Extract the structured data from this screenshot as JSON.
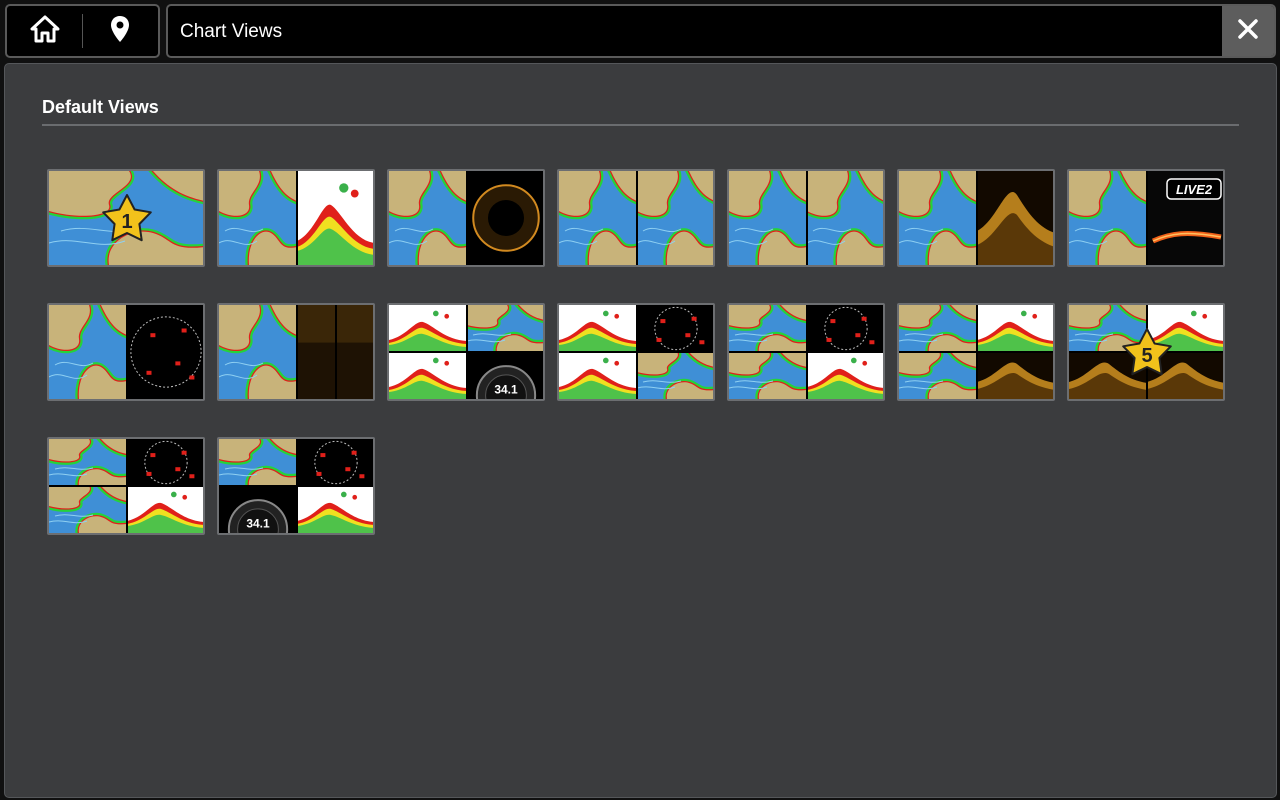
{
  "header": {
    "home_icon": "home-icon",
    "waypoint_icon": "map-pin-icon",
    "title": "Chart Views",
    "close_icon": "close-icon"
  },
  "section": {
    "title": "Default Views"
  },
  "colors": {
    "panel_bg": "#3b3c3e",
    "water": "#3f8fd6",
    "land": "#c8b37a",
    "shallow_green": "#25d33a",
    "contour_red": "#e0201a",
    "star": "#f2c21b",
    "live_text": "LIVE2"
  },
  "views": [
    {
      "id": 1,
      "panes": [
        "chart"
      ],
      "badge": "1"
    },
    {
      "id": 2,
      "panes": [
        "chart",
        "sonar2d"
      ],
      "badge": ""
    },
    {
      "id": 3,
      "panes": [
        "chart",
        "circular"
      ],
      "badge": ""
    },
    {
      "id": 4,
      "panes": [
        "chart",
        "chart"
      ],
      "badge": ""
    },
    {
      "id": 5,
      "panes": [
        "chart",
        "chart"
      ],
      "badge": ""
    },
    {
      "id": 6,
      "panes": [
        "chart",
        "downimage"
      ],
      "badge": ""
    },
    {
      "id": 7,
      "panes": [
        "chart",
        "live"
      ],
      "badge": "",
      "live_label": "LIVE2"
    },
    {
      "id": 8,
      "panes": [
        "chart",
        "radar"
      ],
      "badge": ""
    },
    {
      "id": 9,
      "panes": [
        "chart",
        "sideimage"
      ],
      "badge": ""
    },
    {
      "id": 10,
      "panes": [
        "sonar2d",
        "chart",
        "sonar2d",
        "gauge"
      ],
      "badge": "",
      "gauge_value": "34.1"
    },
    {
      "id": 11,
      "panes": [
        "sonar2d",
        "radar",
        "sonar2d",
        "chart"
      ],
      "badge": ""
    },
    {
      "id": 12,
      "panes": [
        "chart",
        "radar",
        "chart",
        "sonar2d"
      ],
      "badge": ""
    },
    {
      "id": 13,
      "panes": [
        "chart",
        "sonar2d",
        "chart",
        "downimage"
      ],
      "badge": ""
    },
    {
      "id": 14,
      "panes": [
        "chart",
        "sonar2d",
        "downimage",
        "downimage"
      ],
      "badge": "5"
    },
    {
      "id": 15,
      "panes": [
        "chart",
        "radar",
        "chart",
        "sonar2d"
      ],
      "badge": ""
    },
    {
      "id": 16,
      "panes": [
        "chart",
        "radar",
        "gauge",
        "sonar2d"
      ],
      "badge": "",
      "gauge_value": "34.1"
    }
  ]
}
